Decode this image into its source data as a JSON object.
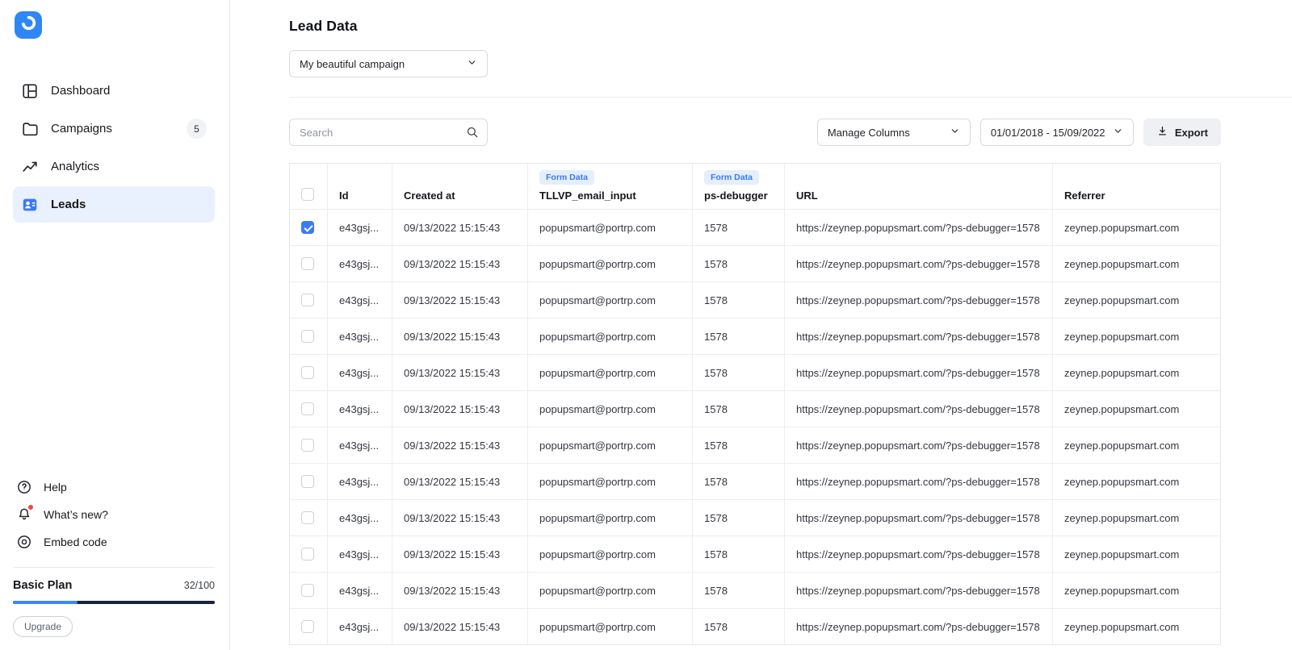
{
  "sidebar": {
    "logo_name": "popupsmart-logo",
    "nav": [
      {
        "label": "Dashboard"
      },
      {
        "label": "Campaigns",
        "badge": "5"
      },
      {
        "label": "Analytics"
      },
      {
        "label": "Leads",
        "active": true
      }
    ],
    "footer_nav": [
      {
        "label": "Help"
      },
      {
        "label": "What’s new?"
      },
      {
        "label": "Embed code"
      }
    ],
    "plan": {
      "name": "Basic Plan",
      "usage": "32/100",
      "progress_pct": 32,
      "upgrade_label": "Upgrade"
    }
  },
  "header": {
    "title": "Lead Data",
    "campaign_select": "My beautiful campaign"
  },
  "toolbar": {
    "search_placeholder": "Search",
    "manage_columns_label": "Manage Columns",
    "date_range_label": "01/01/2018 - 15/09/2022",
    "export_label": "Export"
  },
  "table": {
    "form_data_badge": "Form Data",
    "columns": [
      "Id",
      "Created at",
      "TLLVP_email_input",
      "ps-debugger",
      "URL",
      "Referrer"
    ],
    "rows": [
      {
        "checked": true,
        "id": "e43gsj...",
        "created_at": "09/13/2022 15:15:43",
        "email": "popupsmart@portrp.com",
        "ps_debugger": "1578",
        "url": "https://zeynep.popupsmart.com/?ps-debugger=1578",
        "referrer": "zeynep.popupsmart.com"
      },
      {
        "checked": false,
        "id": "e43gsj...",
        "created_at": "09/13/2022 15:15:43",
        "email": "popupsmart@portrp.com",
        "ps_debugger": "1578",
        "url": "https://zeynep.popupsmart.com/?ps-debugger=1578",
        "referrer": "zeynep.popupsmart.com"
      },
      {
        "checked": false,
        "id": "e43gsj...",
        "created_at": "09/13/2022 15:15:43",
        "email": "popupsmart@portrp.com",
        "ps_debugger": "1578",
        "url": "https://zeynep.popupsmart.com/?ps-debugger=1578",
        "referrer": "zeynep.popupsmart.com"
      },
      {
        "checked": false,
        "id": "e43gsj...",
        "created_at": "09/13/2022 15:15:43",
        "email": "popupsmart@portrp.com",
        "ps_debugger": "1578",
        "url": "https://zeynep.popupsmart.com/?ps-debugger=1578",
        "referrer": "zeynep.popupsmart.com"
      },
      {
        "checked": false,
        "id": "e43gsj...",
        "created_at": "09/13/2022 15:15:43",
        "email": "popupsmart@portrp.com",
        "ps_debugger": "1578",
        "url": "https://zeynep.popupsmart.com/?ps-debugger=1578",
        "referrer": "zeynep.popupsmart.com"
      },
      {
        "checked": false,
        "id": "e43gsj...",
        "created_at": "09/13/2022 15:15:43",
        "email": "popupsmart@portrp.com",
        "ps_debugger": "1578",
        "url": "https://zeynep.popupsmart.com/?ps-debugger=1578",
        "referrer": "zeynep.popupsmart.com"
      },
      {
        "checked": false,
        "id": "e43gsj...",
        "created_at": "09/13/2022 15:15:43",
        "email": "popupsmart@portrp.com",
        "ps_debugger": "1578",
        "url": "https://zeynep.popupsmart.com/?ps-debugger=1578",
        "referrer": "zeynep.popupsmart.com"
      },
      {
        "checked": false,
        "id": "e43gsj...",
        "created_at": "09/13/2022 15:15:43",
        "email": "popupsmart@portrp.com",
        "ps_debugger": "1578",
        "url": "https://zeynep.popupsmart.com/?ps-debugger=1578",
        "referrer": "zeynep.popupsmart.com"
      },
      {
        "checked": false,
        "id": "e43gsj...",
        "created_at": "09/13/2022 15:15:43",
        "email": "popupsmart@portrp.com",
        "ps_debugger": "1578",
        "url": "https://zeynep.popupsmart.com/?ps-debugger=1578",
        "referrer": "zeynep.popupsmart.com"
      },
      {
        "checked": false,
        "id": "e43gsj...",
        "created_at": "09/13/2022 15:15:43",
        "email": "popupsmart@portrp.com",
        "ps_debugger": "1578",
        "url": "https://zeynep.popupsmart.com/?ps-debugger=1578",
        "referrer": "zeynep.popupsmart.com"
      },
      {
        "checked": false,
        "id": "e43gsj...",
        "created_at": "09/13/2022 15:15:43",
        "email": "popupsmart@portrp.com",
        "ps_debugger": "1578",
        "url": "https://zeynep.popupsmart.com/?ps-debugger=1578",
        "referrer": "zeynep.popupsmart.com"
      },
      {
        "checked": false,
        "id": "e43gsj...",
        "created_at": "09/13/2022 15:15:43",
        "email": "popupsmart@portrp.com",
        "ps_debugger": "1578",
        "url": "https://zeynep.popupsmart.com/?ps-debugger=1578",
        "referrer": "zeynep.popupsmart.com"
      }
    ]
  },
  "colors": {
    "accent_blue": "#3a7af5",
    "active_item_bg": "#eaf1fe",
    "badge_bg": "#e5eefb",
    "table_border": "#ededf1",
    "export_bg": "#eef0f3",
    "progress_fill": "#3f83f8",
    "progress_track": "#19233e",
    "notification_dot": "#e84b3c"
  }
}
